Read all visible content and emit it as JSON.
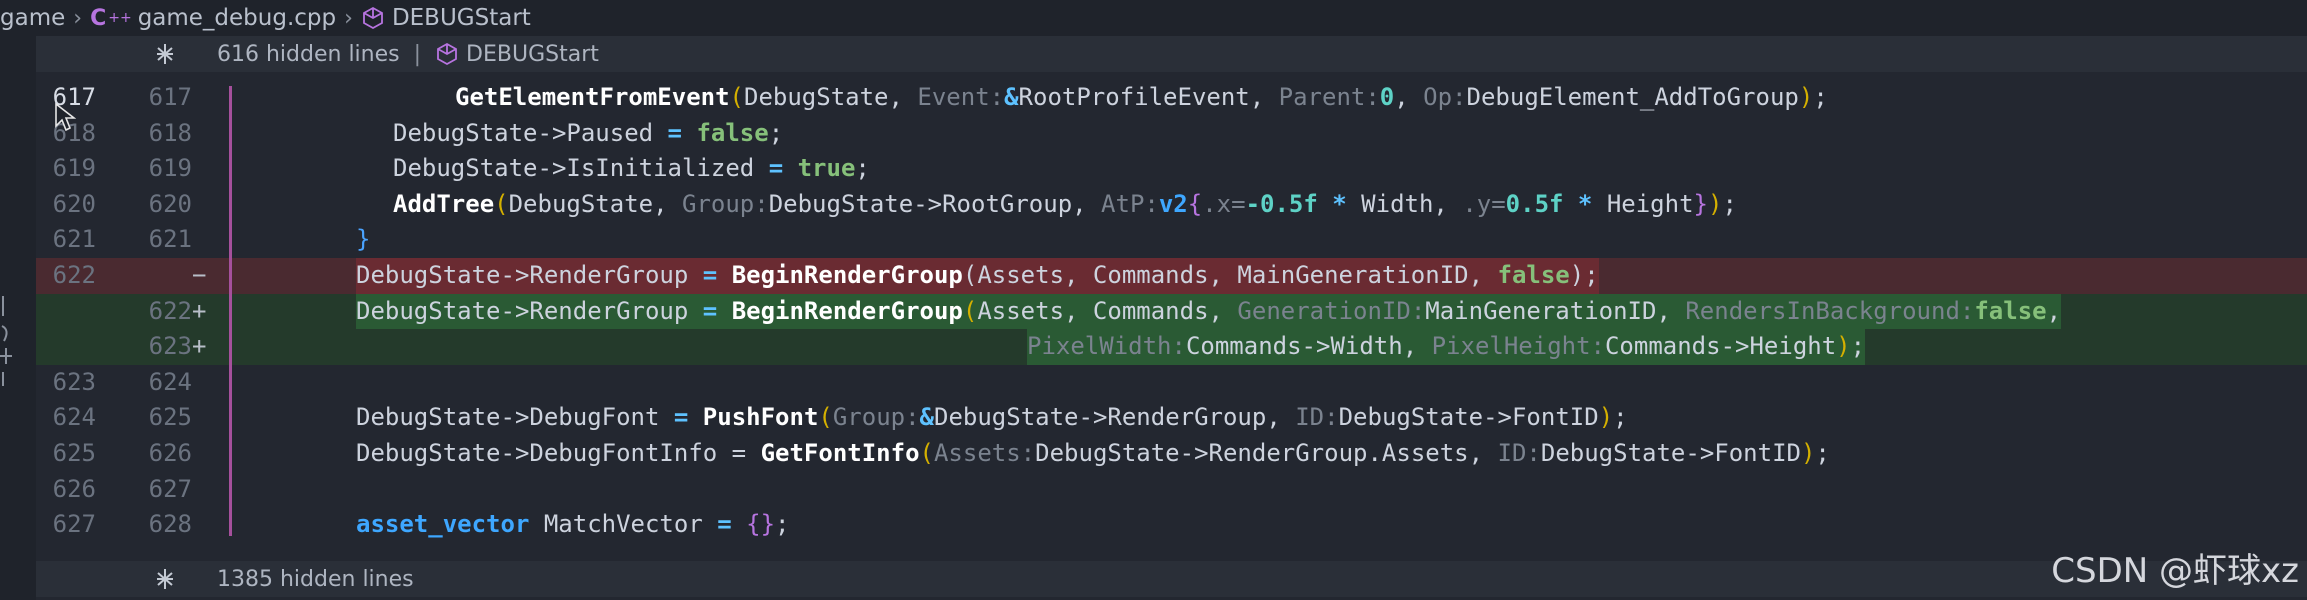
{
  "breadcrumb": {
    "items": [
      "game",
      "game_debug.cpp",
      "DEBUGStart"
    ],
    "cpp_icon": "C++"
  },
  "folds": {
    "top": {
      "text": "616 hidden lines",
      "divider": "|",
      "symbol": "DEBUGStart"
    },
    "bottom": {
      "text": "1385 hidden lines"
    }
  },
  "lines": [
    {
      "old": "617",
      "new": "617",
      "mark": "",
      "kind": "ctx"
    },
    {
      "old": "618",
      "new": "618",
      "mark": "",
      "kind": "ctx"
    },
    {
      "old": "619",
      "new": "619",
      "mark": "",
      "kind": "ctx"
    },
    {
      "old": "620",
      "new": "620",
      "mark": "",
      "kind": "ctx"
    },
    {
      "old": "621",
      "new": "621",
      "mark": "",
      "kind": "ctx"
    },
    {
      "old": "622",
      "new": "",
      "mark": "−",
      "kind": "removed"
    },
    {
      "old": "",
      "new": "622",
      "mark": "+",
      "kind": "added"
    },
    {
      "old": "",
      "new": "623",
      "mark": "+",
      "kind": "added"
    },
    {
      "old": "623",
      "new": "624",
      "mark": "",
      "kind": "ctx"
    },
    {
      "old": "624",
      "new": "625",
      "mark": "",
      "kind": "ctx"
    },
    {
      "old": "625",
      "new": "626",
      "mark": "",
      "kind": "ctx"
    },
    {
      "old": "626",
      "new": "627",
      "mark": "",
      "kind": "ctx"
    },
    {
      "old": "627",
      "new": "628",
      "mark": "",
      "kind": "ctx"
    }
  ],
  "code": {
    "l0": [
      [
        "GetElementFromEvent",
        "fn"
      ],
      [
        "(",
        "paren"
      ],
      [
        "DebugState, ",
        ""
      ],
      [
        "Event:",
        "hint"
      ],
      [
        "&",
        "op"
      ],
      [
        "RootProfileEvent, ",
        ""
      ],
      [
        "Parent:",
        "hint"
      ],
      [
        "0",
        "num"
      ],
      [
        ", ",
        ""
      ],
      [
        "Op:",
        "hint"
      ],
      [
        "DebugElement_AddToGroup",
        ""
      ],
      [
        ")",
        "paren"
      ],
      [
        ";",
        ""
      ]
    ],
    "l1": [
      [
        "DebugState->Paused ",
        ""
      ],
      [
        "=",
        "op"
      ],
      [
        " ",
        ""
      ],
      [
        "false",
        "bool"
      ],
      [
        ";",
        ""
      ]
    ],
    "l2": [
      [
        "DebugState->IsInitialized ",
        ""
      ],
      [
        "=",
        "op"
      ],
      [
        " ",
        ""
      ],
      [
        "true",
        "bool"
      ],
      [
        ";",
        ""
      ]
    ],
    "l3": [
      [
        "AddTree",
        "fn"
      ],
      [
        "(",
        "paren"
      ],
      [
        "DebugState, ",
        ""
      ],
      [
        "Group:",
        "hint"
      ],
      [
        "DebugState->RootGroup, ",
        ""
      ],
      [
        "AtP:",
        "hint"
      ],
      [
        "v2",
        "type"
      ],
      [
        "{",
        "brace"
      ],
      [
        ".x=",
        "hint"
      ],
      [
        "-0.5f",
        "num"
      ],
      [
        " ",
        ""
      ],
      [
        "*",
        "op"
      ],
      [
        " Width, ",
        ""
      ],
      [
        ".y=",
        "hint"
      ],
      [
        "0.5f",
        "num"
      ],
      [
        " ",
        ""
      ],
      [
        "*",
        "op"
      ],
      [
        " Height",
        ""
      ],
      [
        "}",
        "brace"
      ],
      [
        ")",
        "paren"
      ],
      [
        ";",
        ""
      ]
    ],
    "l4": [
      [
        "}",
        "bracet"
      ]
    ],
    "l5": [
      [
        "DebugState->RenderGroup ",
        ""
      ],
      [
        "=",
        "op"
      ],
      [
        " ",
        ""
      ],
      [
        "BeginRenderGroup",
        "fn"
      ],
      [
        "(Assets, Commands, MainGenerationID, ",
        ""
      ],
      [
        "false",
        "bool"
      ],
      [
        ");",
        ""
      ]
    ],
    "l6": [
      [
        "DebugState->RenderGroup ",
        ""
      ],
      [
        "=",
        "op"
      ],
      [
        " ",
        ""
      ],
      [
        "BeginRenderGroup",
        "fn"
      ],
      [
        "(",
        "paren"
      ],
      [
        "Assets, Commands, ",
        ""
      ],
      [
        "GenerationID:",
        "hint"
      ],
      [
        "MainGenerationID, ",
        ""
      ],
      [
        "RendersInBackground:",
        "hint"
      ],
      [
        "false",
        "bool"
      ],
      [
        ",",
        ""
      ]
    ],
    "l7": [
      [
        "PixelWidth:",
        "hint"
      ],
      [
        "Commands->Width, ",
        ""
      ],
      [
        "PixelHeight:",
        "hint"
      ],
      [
        "Commands->Height",
        ""
      ],
      [
        ")",
        "paren"
      ],
      [
        ";",
        ""
      ]
    ],
    "l8": [],
    "l9": [
      [
        "DebugState->DebugFont ",
        ""
      ],
      [
        "=",
        "op"
      ],
      [
        " ",
        ""
      ],
      [
        "PushFont",
        "fn"
      ],
      [
        "(",
        "paren"
      ],
      [
        "Group:",
        "hint"
      ],
      [
        "&",
        "op"
      ],
      [
        "DebugState->RenderGroup, ",
        ""
      ],
      [
        "ID:",
        "hint"
      ],
      [
        "DebugState->FontID",
        ""
      ],
      [
        ")",
        "paren"
      ],
      [
        ";",
        ""
      ]
    ],
    "l10": [
      [
        "DebugState->DebugFontInfo = ",
        ""
      ],
      [
        "GetFontInfo",
        "fn"
      ],
      [
        "(",
        "paren"
      ],
      [
        "Assets:",
        "hint"
      ],
      [
        "DebugState->RenderGroup.Assets, ",
        ""
      ],
      [
        "ID:",
        "hint"
      ],
      [
        "DebugState->FontID",
        ""
      ],
      [
        ")",
        "paren"
      ],
      [
        ";",
        ""
      ]
    ],
    "l11": [],
    "l12": [
      [
        "asset_vector",
        "type"
      ],
      [
        " MatchVector ",
        ""
      ],
      [
        "=",
        "op"
      ],
      [
        " ",
        ""
      ],
      [
        "{}",
        "brace"
      ],
      [
        ";",
        ""
      ]
    ]
  },
  "watermark": "CSDN @虾球xz",
  "icons": {
    "cpp": "cpp-file-icon",
    "symbol": "cube-icon",
    "unfold": "unfold-icon",
    "cursor": "mouse-cursor-icon"
  }
}
